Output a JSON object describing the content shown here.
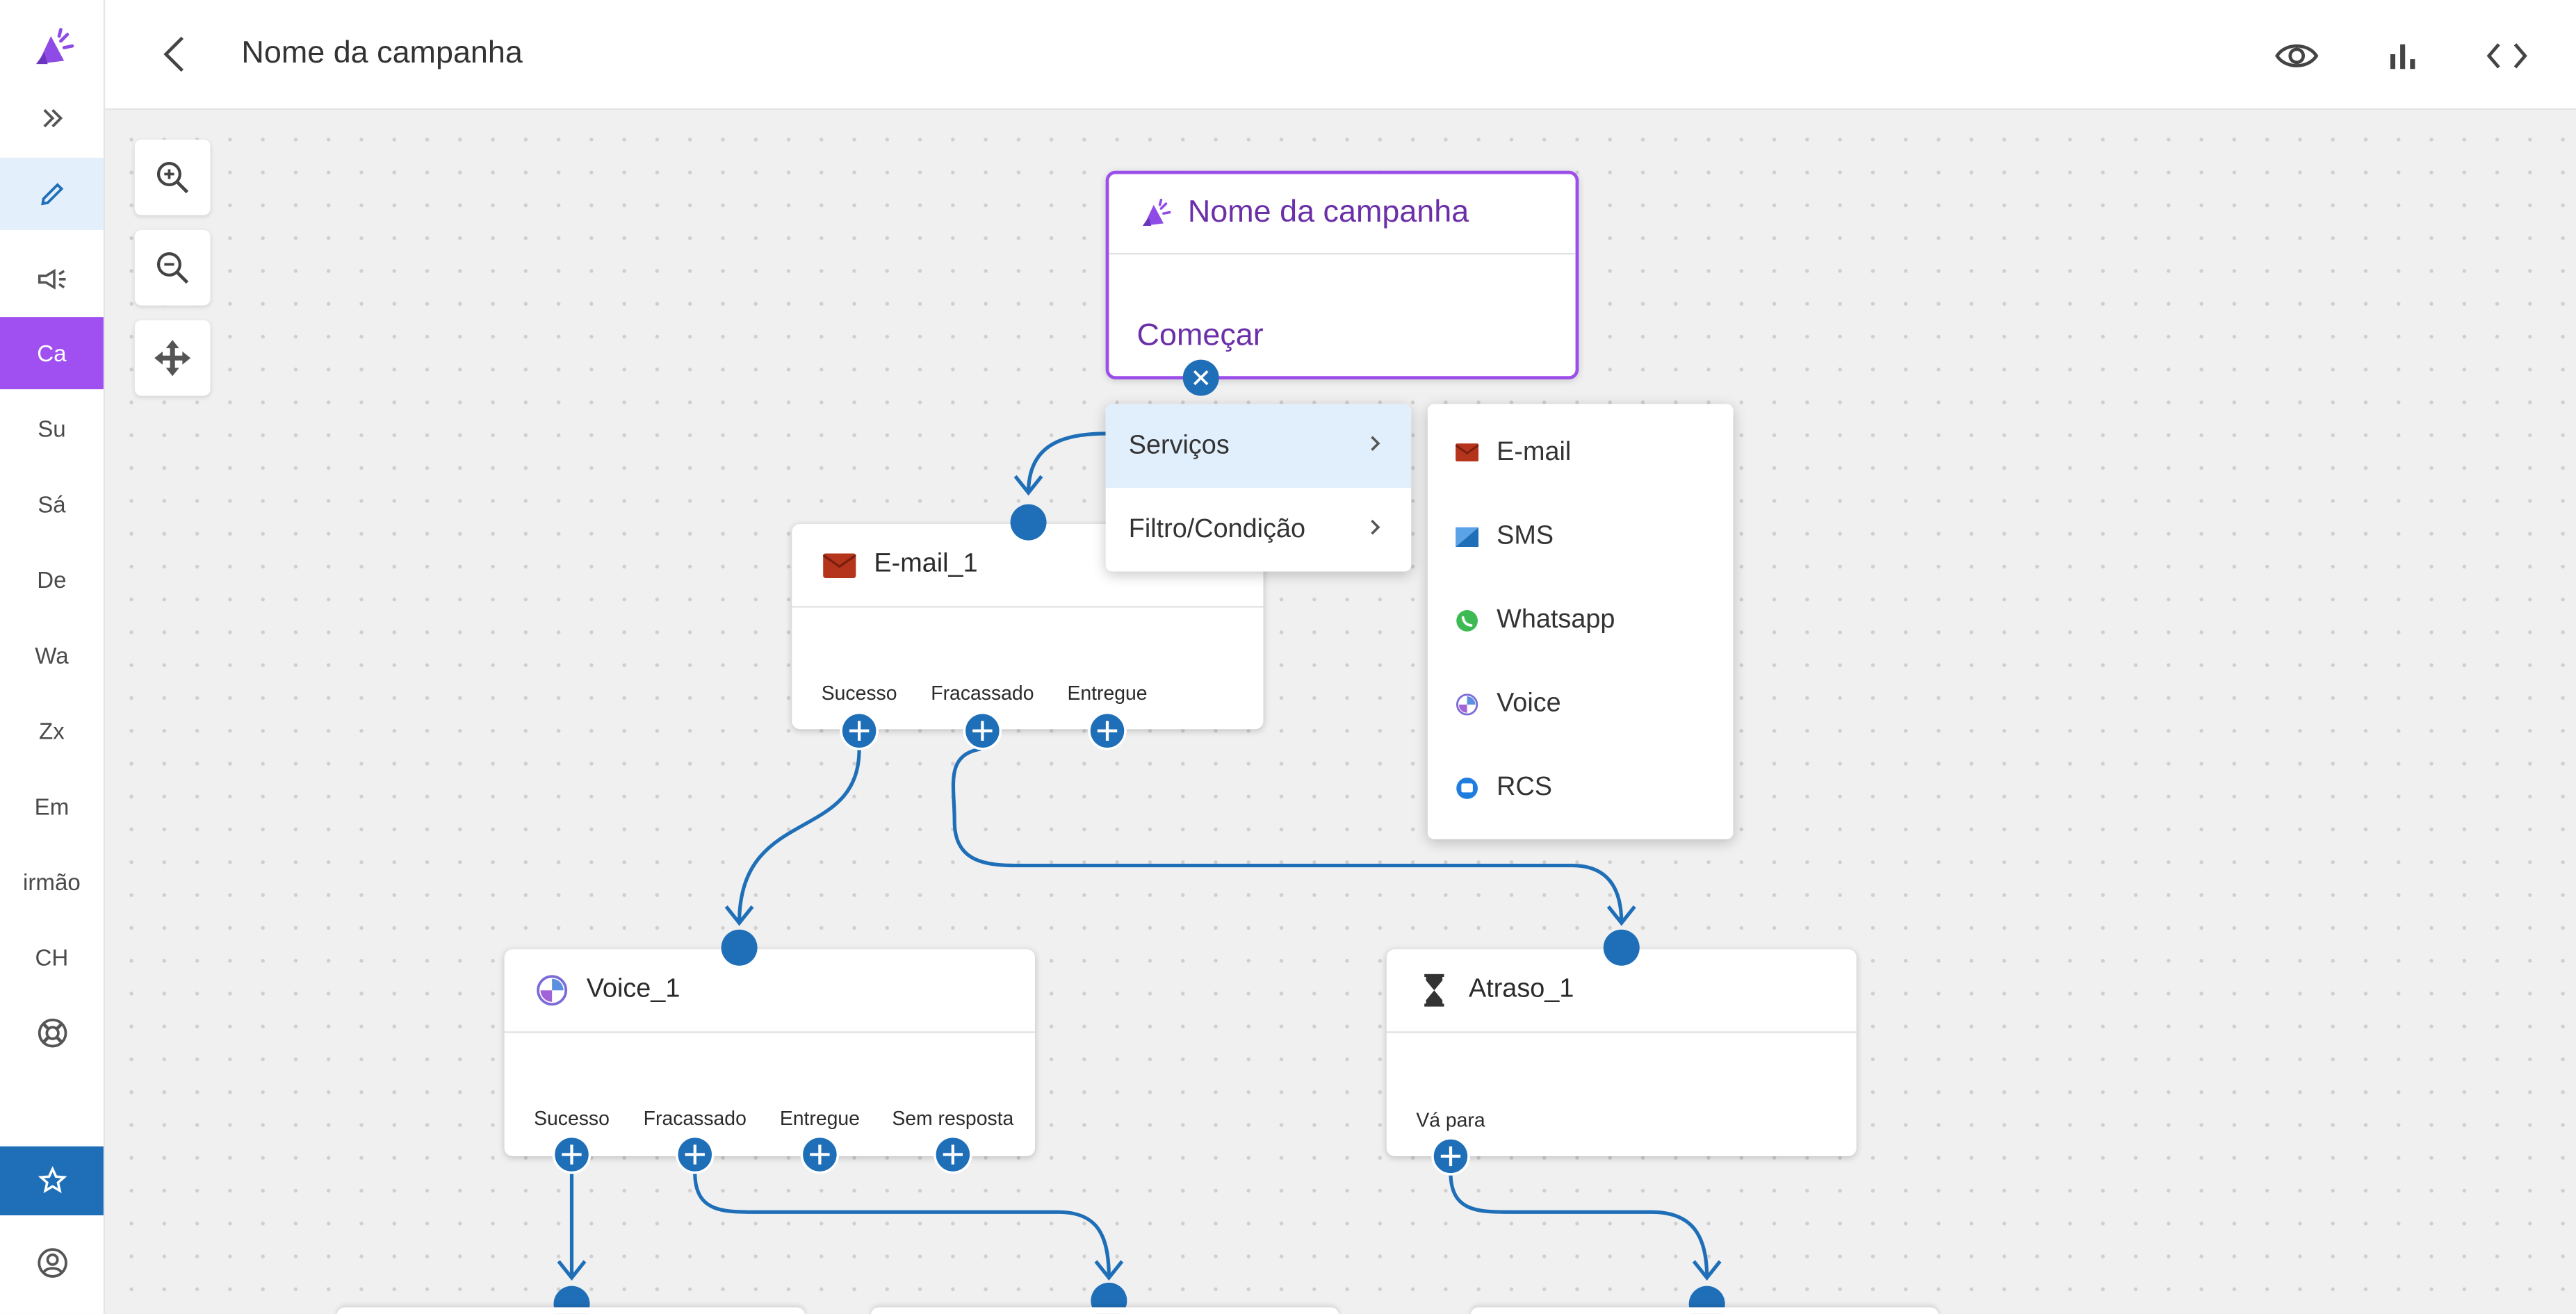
{
  "header": {
    "title": "Nome da campanha"
  },
  "sidebar": {
    "items": [
      {
        "label": "Ca"
      },
      {
        "label": "Su"
      },
      {
        "label": "Sá"
      },
      {
        "label": "De"
      },
      {
        "label": "Wa"
      },
      {
        "label": "Zx"
      },
      {
        "label": "Em"
      },
      {
        "label": "irmão"
      },
      {
        "label": "CH"
      }
    ]
  },
  "start_node": {
    "title": "Nome da campanha",
    "start_label": "Começar"
  },
  "context_menu": {
    "items": [
      {
        "label": "Serviços"
      },
      {
        "label": "Filtro/Condição"
      }
    ],
    "submenu": [
      {
        "label": "E-mail",
        "icon": "envelope-icon"
      },
      {
        "label": "SMS",
        "icon": "sms-icon"
      },
      {
        "label": "Whatsapp",
        "icon": "whatsapp-icon"
      },
      {
        "label": "Voice",
        "icon": "voice-icon"
      },
      {
        "label": "RCS",
        "icon": "rcs-icon"
      }
    ]
  },
  "nodes": {
    "email": {
      "title": "E-mail_1",
      "ports": [
        "Sucesso",
        "Fracassado",
        "Entregue"
      ]
    },
    "voice": {
      "title": "Voice_1",
      "ports": [
        "Sucesso",
        "Fracassado",
        "Entregue",
        "Sem resposta"
      ]
    },
    "delay": {
      "title": "Atraso_1",
      "ports": [
        "Vá para"
      ]
    }
  },
  "colors": {
    "accent": "#1f6fb8",
    "purple": "#9b4ee9",
    "purple_text": "#6b2fa8",
    "highlight": "#e1eefb"
  }
}
